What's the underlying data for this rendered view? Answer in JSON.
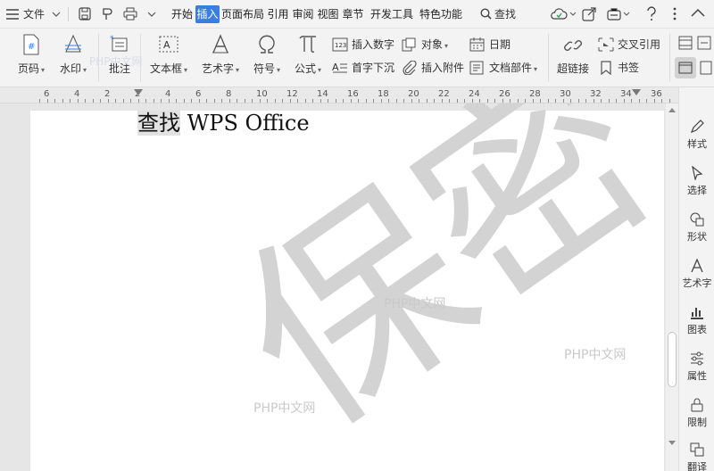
{
  "menubar": {
    "menu_label": "文件",
    "tabs": [
      "开始",
      "插入",
      "页面布局",
      "引用",
      "审阅",
      "视图",
      "章节",
      "开发工具",
      "特色功能"
    ],
    "active_tab": "插入",
    "search_label": "查找"
  },
  "ribbon": {
    "page_number": "页码",
    "watermark": "水印",
    "comment": "批注",
    "textbox": "文本框",
    "wordart": "艺术字",
    "symbol": "符号",
    "formula": "公式",
    "insert_number": "插入数字",
    "object": "对象",
    "date": "日期",
    "drop_cap": "首字下沉",
    "attachment": "插入附件",
    "doc_parts": "文档部件",
    "hyperlink": "超链接",
    "cross_reference": "交叉引用",
    "bookmark": "书签"
  },
  "ruler": {
    "numbers": [
      "6",
      "4",
      "2",
      "2",
      "4",
      "6",
      "8",
      "10",
      "12",
      "14",
      "16",
      "18",
      "20",
      "22",
      "24",
      "26",
      "28",
      "30",
      "32",
      "34",
      "36"
    ]
  },
  "document": {
    "title_highlight": "查找",
    "title_rest": " WPS Office",
    "watermark_glyphs": "保密",
    "watermark_text": "PHP中文网",
    "watermark_color": "#d3d3d3"
  },
  "right_panel": {
    "items": [
      "样式",
      "选择",
      "形状",
      "艺术字",
      "图表",
      "属性",
      "限制",
      "翻译"
    ]
  },
  "colors": {
    "accent": "#3b7ee3",
    "ribbon_bg": "#f3f3f3"
  }
}
